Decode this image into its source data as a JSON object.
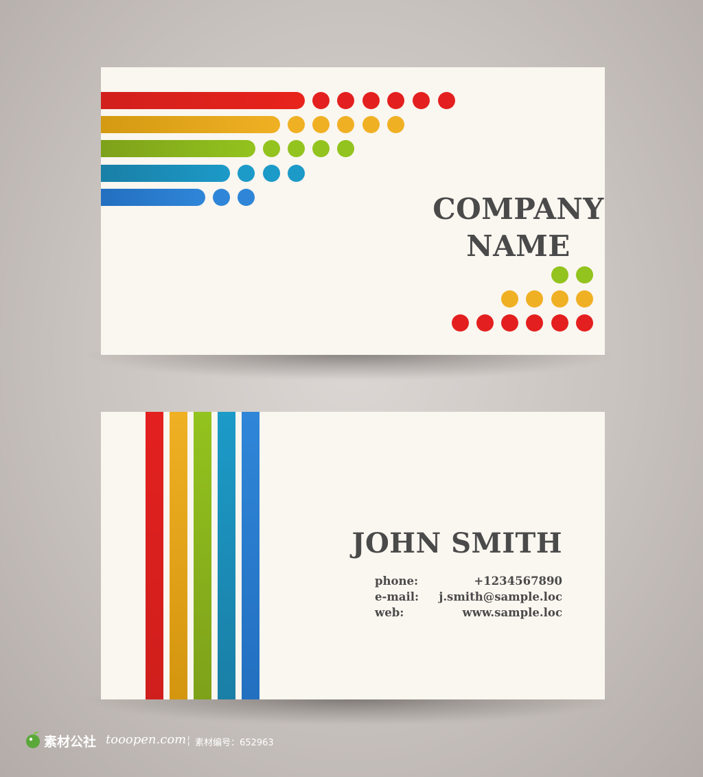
{
  "front": {
    "company_line1": "COMPANY",
    "company_line2": "NAME"
  },
  "back": {
    "name": "JOHN SMITH",
    "phone_label": "phone:",
    "phone_value": "+1234567890",
    "email_label": "e-mail:",
    "email_value": "j.smith@sample.loc",
    "web_label": "web:",
    "web_value": "www.sample.loc"
  },
  "watermark": {
    "brand": "素材公社",
    "site": "tooopen.com",
    "id_text": "素材编号：652963"
  },
  "colors": {
    "background": "#c9c3bf",
    "card": "#faf6f0",
    "text": "#4a4a4a",
    "red": "#e3201f",
    "orange": "#f0b024",
    "green": "#93c31e",
    "teal": "#1c9ac8",
    "blue": "#2f86d8"
  }
}
